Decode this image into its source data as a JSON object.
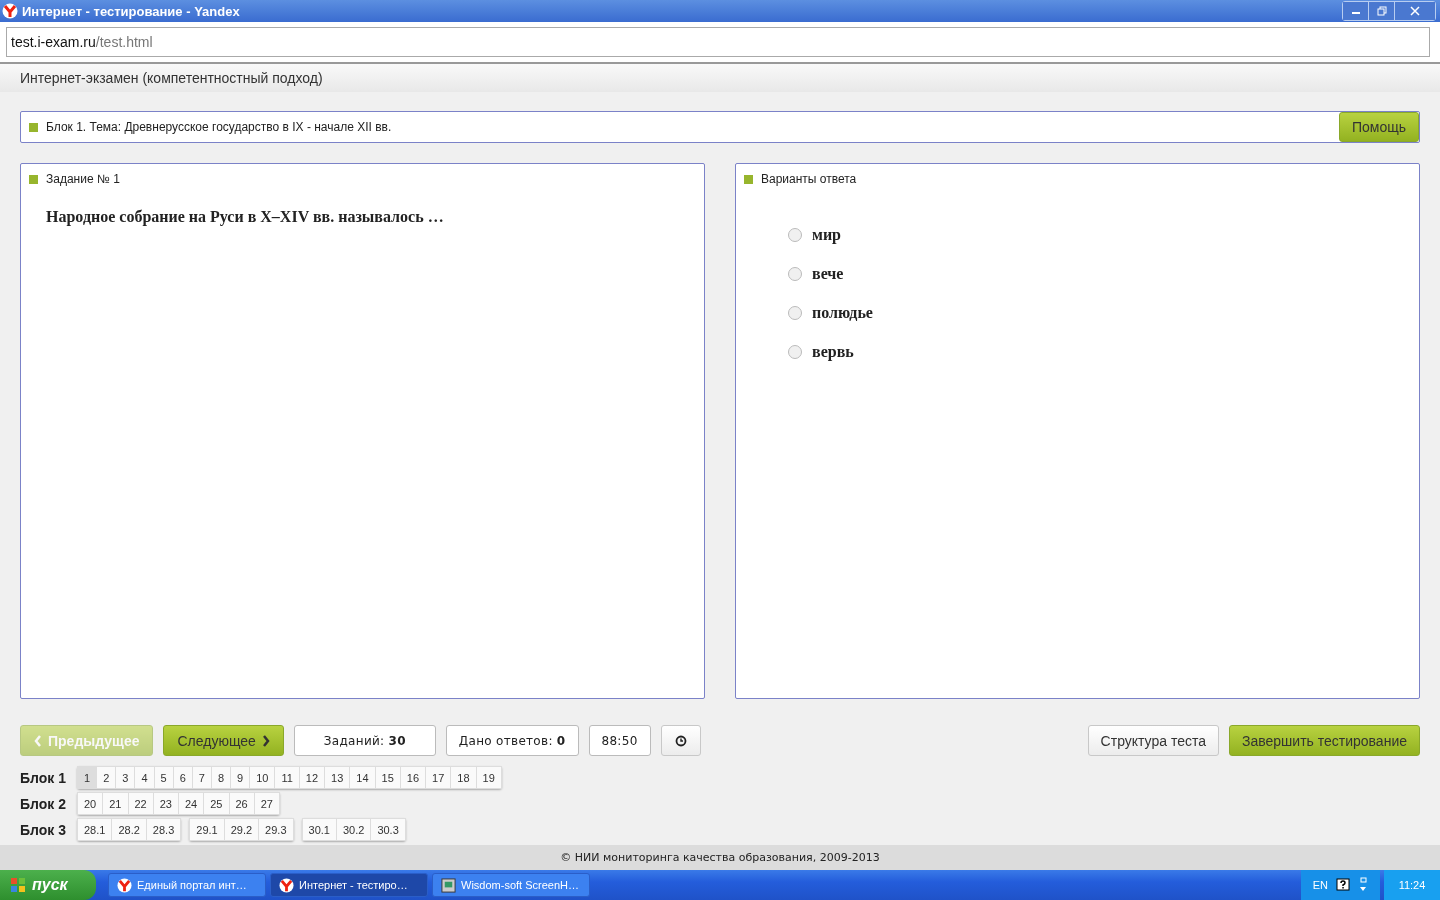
{
  "window": {
    "title": "Интернет - тестирование - Yandex"
  },
  "address": {
    "domain": "test.i-exam.ru",
    "path": "/test.html"
  },
  "header": "Интернет-экзамен (компетентностный подход)",
  "block_bar": {
    "text": "Блок 1. Тема: Древнерусское государство в IX - начале XII вв.",
    "help": "Помощь"
  },
  "task_panel": {
    "title": "Задание № 1",
    "question": "Народное собрание на Руси в X–XIV вв. называлось …"
  },
  "answers_panel": {
    "title": "Варианты ответа",
    "options": [
      {
        "text": "мир",
        "selected": false
      },
      {
        "text": "вече",
        "selected": false
      },
      {
        "text": "полюдье",
        "selected": false
      },
      {
        "text": "вервь",
        "selected": false
      }
    ]
  },
  "nav": {
    "prev": {
      "label": "Предыдущее",
      "disabled": true
    },
    "next": {
      "label": "Следующее",
      "disabled": false
    },
    "tasks": "Заданий: **30**",
    "answered": "Дано ответов: **0**",
    "timer": "88:50",
    "structure": "Структура теста",
    "finish": "Завершить тестирование"
  },
  "blocks": [
    {
      "label": "Блок 1",
      "groups": [
        [
          {
            "label": "1",
            "selected": true
          },
          {
            "label": "2",
            "selected": false
          },
          {
            "label": "3",
            "selected": false
          },
          {
            "label": "4",
            "selected": false
          },
          {
            "label": "5",
            "selected": false
          },
          {
            "label": "6",
            "selected": false
          },
          {
            "label": "7",
            "selected": false
          },
          {
            "label": "8",
            "selected": false
          },
          {
            "label": "9",
            "selected": false
          },
          {
            "label": "10",
            "selected": false
          },
          {
            "label": "11",
            "selected": false
          },
          {
            "label": "12",
            "selected": false
          },
          {
            "label": "13",
            "selected": false
          },
          {
            "label": "14",
            "selected": false
          },
          {
            "label": "15",
            "selected": false
          },
          {
            "label": "16",
            "selected": false
          },
          {
            "label": "17",
            "selected": false
          },
          {
            "label": "18",
            "selected": false
          },
          {
            "label": "19",
            "selected": false
          }
        ]
      ]
    },
    {
      "label": "Блок 2",
      "groups": [
        [
          {
            "label": "20",
            "selected": false
          },
          {
            "label": "21",
            "selected": false
          },
          {
            "label": "22",
            "selected": false
          },
          {
            "label": "23",
            "selected": false
          },
          {
            "label": "24",
            "selected": false
          },
          {
            "label": "25",
            "selected": false
          },
          {
            "label": "26",
            "selected": false
          },
          {
            "label": "27",
            "selected": false
          }
        ]
      ]
    },
    {
      "label": "Блок 3",
      "groups": [
        [
          {
            "label": "28.1",
            "selected": false
          },
          {
            "label": "28.2",
            "selected": false
          },
          {
            "label": "28.3",
            "selected": false
          }
        ],
        [
          {
            "label": "29.1",
            "selected": false
          },
          {
            "label": "29.2",
            "selected": false
          },
          {
            "label": "29.3",
            "selected": false
          }
        ],
        [
          {
            "label": "30.1",
            "selected": false
          },
          {
            "label": "30.2",
            "selected": false
          },
          {
            "label": "30.3",
            "selected": false
          }
        ]
      ]
    }
  ],
  "footer": "© НИИ мониторинга качества образования, 2009-2013",
  "taskbar": {
    "start": "пуск",
    "items": [
      {
        "label": "Единый портал инт…",
        "kind": "browser",
        "selected": false
      },
      {
        "label": "Интернет - тестиро…",
        "kind": "browser",
        "selected": true
      },
      {
        "label": "Wisdom-soft ScreenH…",
        "kind": "app",
        "selected": false
      }
    ],
    "lang": "EN",
    "time": "11:24"
  }
}
